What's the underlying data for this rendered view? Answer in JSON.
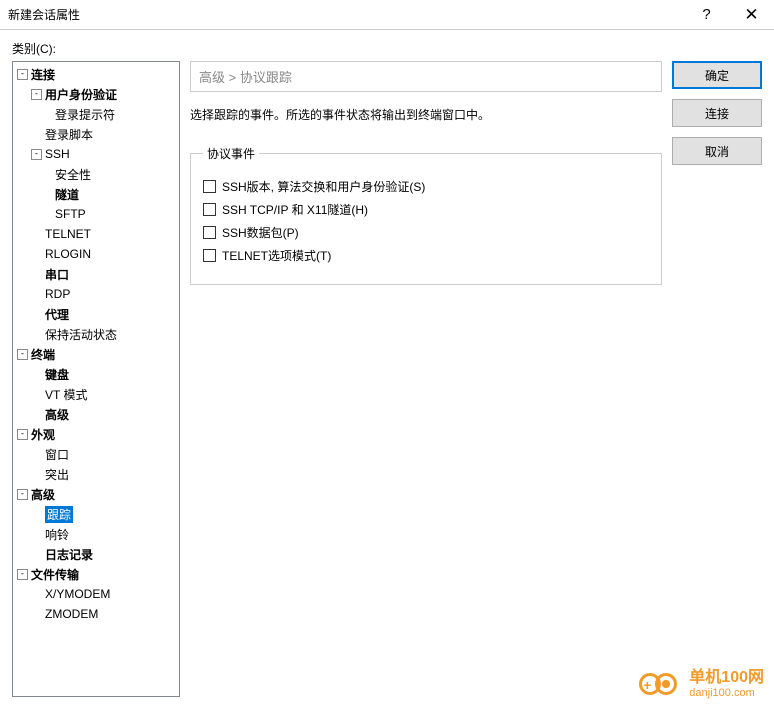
{
  "window": {
    "title": "新建会话属性",
    "help": "?",
    "close": "✕"
  },
  "category_label": "类别(C):",
  "tree": {
    "connection": {
      "label": "连接",
      "user_auth": "用户身份验证",
      "login_prompt": "登录提示符",
      "login_script": "登录脚本",
      "ssh": {
        "label": "SSH",
        "security": "安全性",
        "tunnel": "隧道",
        "sftp": "SFTP"
      },
      "telnet": "TELNET",
      "rlogin": "RLOGIN",
      "serial": "串口",
      "rdp": "RDP",
      "proxy": "代理",
      "keepalive": "保持活动状态"
    },
    "terminal": {
      "label": "终端",
      "keyboard": "键盘",
      "vt": "VT 模式",
      "advanced": "高级"
    },
    "appearance": {
      "label": "外观",
      "window": "窗口",
      "highlight": "突出"
    },
    "advanced": {
      "label": "高级",
      "trace": "跟踪",
      "bell": "响铃",
      "log": "日志记录"
    },
    "filetransfer": {
      "label": "文件传输",
      "xymodem": "X/YMODEM",
      "zmodem": "ZMODEM"
    }
  },
  "breadcrumb": "高级 > 协议跟踪",
  "description": "选择跟踪的事件。所选的事件状态将输出到终端窗口中。",
  "fieldset_title": "协议事件",
  "checks": {
    "ssh_version": "SSH版本, 算法交换和用户身份验证(S)",
    "ssh_tcp": "SSH TCP/IP 和 X11隧道(H)",
    "ssh_packet": "SSH数据包(P)",
    "telnet_opt": "TELNET选项模式(T)"
  },
  "buttons": {
    "ok": "确定",
    "connect": "连接",
    "cancel": "取消"
  },
  "watermark": {
    "name": "单机100网",
    "url": "danji100.com"
  }
}
